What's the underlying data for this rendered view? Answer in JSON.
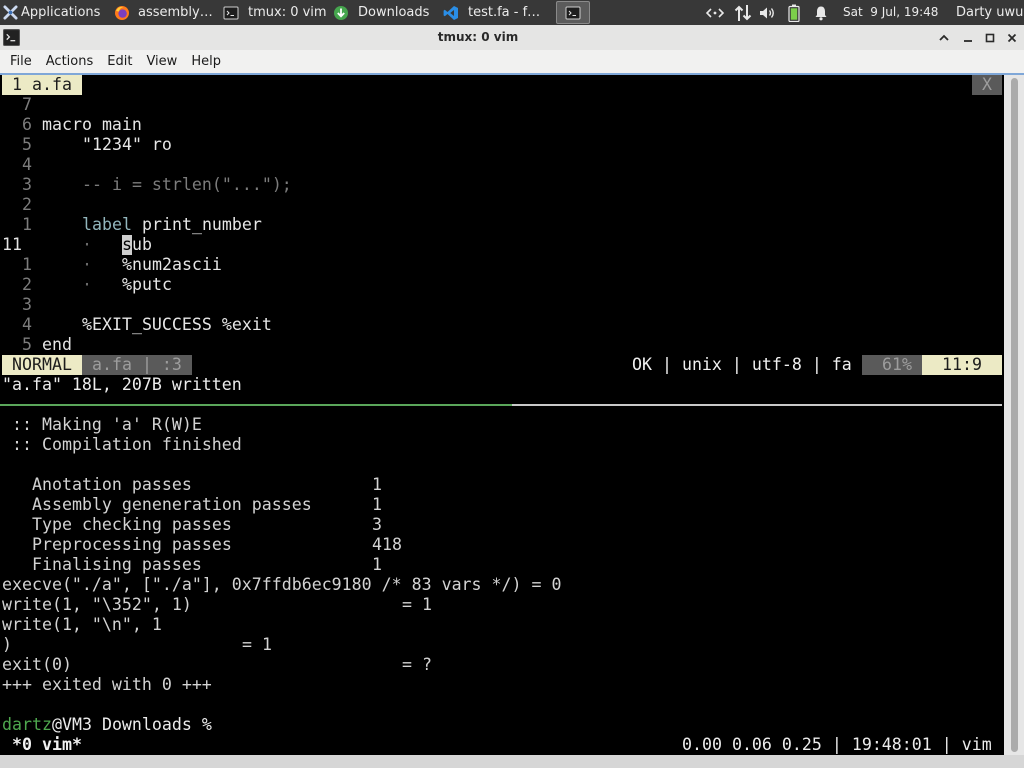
{
  "top_panel": {
    "applications": "Applications",
    "tasks": [
      {
        "icon": "firefox-icon",
        "label": "assembly…"
      },
      {
        "icon": "terminal-icon",
        "label": "tmux: 0 vim"
      },
      {
        "icon": "download-icon",
        "label": "Downloads"
      },
      {
        "icon": "vscode-icon",
        "label": "test.fa - f…"
      },
      {
        "icon": "terminal-icon"
      }
    ],
    "tray_icons": [
      "network-icon",
      "transfer-arrows-icon",
      "volume-icon",
      "battery-icon",
      "notification-bell-icon"
    ],
    "clock": "Sat  9 Jul, 19:48",
    "user": "Darty uwu"
  },
  "window": {
    "title": "tmux: 0 vim",
    "menu": [
      "File",
      "Actions",
      "Edit",
      "View",
      "Help"
    ]
  },
  "vim": {
    "tab_label": "1 a.fa",
    "tab_close": "X",
    "lines": [
      {
        "number": "7"
      },
      {
        "number": "6",
        "code": "macro main"
      },
      {
        "number": "5",
        "code": "\"1234\" ro"
      },
      {
        "number": "4"
      },
      {
        "number": "3",
        "comment": "-- i = strlen(\"...\");"
      },
      {
        "number": "2"
      },
      {
        "number": "1",
        "keyword": "label",
        "code": "print_number"
      },
      {
        "number": "11",
        "indent": "·",
        "cursor_char": "s",
        "code": "ub"
      },
      {
        "number": "1",
        "indent": "·",
        "code": "%num2ascii"
      },
      {
        "number": "2",
        "indent": "·",
        "code": "%putc"
      },
      {
        "number": "3"
      },
      {
        "number": "4",
        "code": "%EXIT_SUCCESS %exit"
      },
      {
        "number": "5",
        "code": "end"
      }
    ],
    "statusline": {
      "mode": "NORMAL",
      "file": "a.fa | :3",
      "info": "OK | unix | utf-8 | fa",
      "percent": "61%",
      "position": "11:9"
    },
    "message": "\"a.fa\" 18L, 207B written"
  },
  "shell": {
    "build": [
      ":: Making 'a' R(W)E",
      ":: Compilation finished"
    ],
    "passes": [
      {
        "name": "Anotation passes",
        "count": "1"
      },
      {
        "name": "Assembly geneneration passes",
        "count": "1"
      },
      {
        "name": "Type checking passes",
        "count": "3"
      },
      {
        "name": "Preprocessing passes",
        "count": "418"
      },
      {
        "name": "Finalising passes",
        "count": "1"
      }
    ],
    "strace": [
      {
        "call": "execve(\"./a\", [\"./a\"], 0x7ffdb6ec9180 /* 83 vars */) = 0"
      },
      {
        "call": "write(1, \"\\352\", 1)",
        "result": "= 1"
      },
      {
        "call": "write(1, \"\\n\", 1"
      },
      {
        "call": ")",
        "result": "= 1"
      },
      {
        "call": "exit(0)",
        "result": "= ?"
      },
      {
        "call": "+++ exited with 0 +++"
      }
    ],
    "prompt": {
      "user": "dartz",
      "rest": "@VM3 Downloads %"
    }
  },
  "tmux_status": {
    "window": "*0 vim*",
    "right": "0.00 0.06 0.25 | 19:48:01 | vim"
  },
  "colors": {
    "panel_bg": "#383838",
    "terminal_bg": "#000000",
    "focus_border": "#7fa7d8",
    "vim_status_light": "#eceac5",
    "vim_status_gray": "#5a5a5a",
    "pane_border_active": "#5aa65a",
    "prompt_user": "#4ea84e"
  }
}
